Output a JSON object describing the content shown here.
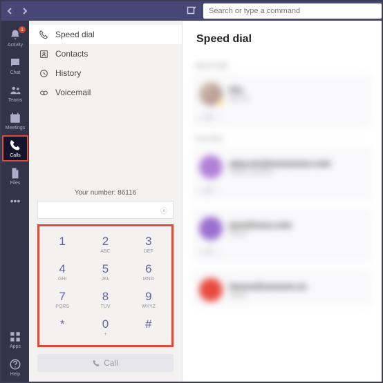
{
  "topbar": {
    "search_placeholder": "Search or type a command"
  },
  "rail": {
    "items": [
      {
        "label": "Activity"
      },
      {
        "label": "Chat"
      },
      {
        "label": "Teams"
      },
      {
        "label": "Meetings"
      },
      {
        "label": "Calls"
      },
      {
        "label": "Files"
      }
    ],
    "badge": "1",
    "apps": "Apps",
    "help": "Help"
  },
  "calls_panel": {
    "tabs": [
      {
        "label": "Speed dial"
      },
      {
        "label": "Contacts"
      },
      {
        "label": "History"
      },
      {
        "label": "Voicemail"
      }
    ],
    "your_number": "Your number: 86116",
    "call_button": "Call",
    "keys": [
      {
        "digit": "1",
        "letters": ""
      },
      {
        "digit": "2",
        "letters": "ABC"
      },
      {
        "digit": "3",
        "letters": "DEF"
      },
      {
        "digit": "4",
        "letters": "GHI"
      },
      {
        "digit": "5",
        "letters": "JKL"
      },
      {
        "digit": "6",
        "letters": "MNO"
      },
      {
        "digit": "7",
        "letters": "PQRS"
      },
      {
        "digit": "8",
        "letters": "TUV"
      },
      {
        "digit": "9",
        "letters": "WXYZ"
      },
      {
        "digit": "*",
        "letters": ""
      },
      {
        "digit": "0",
        "letters": "+"
      },
      {
        "digit": "#",
        "letters": ""
      }
    ]
  },
  "content": {
    "title": "Speed dial",
    "sections": [
      {
        "label": "Speed dial"
      },
      {
        "label": "Favorites"
      }
    ]
  }
}
